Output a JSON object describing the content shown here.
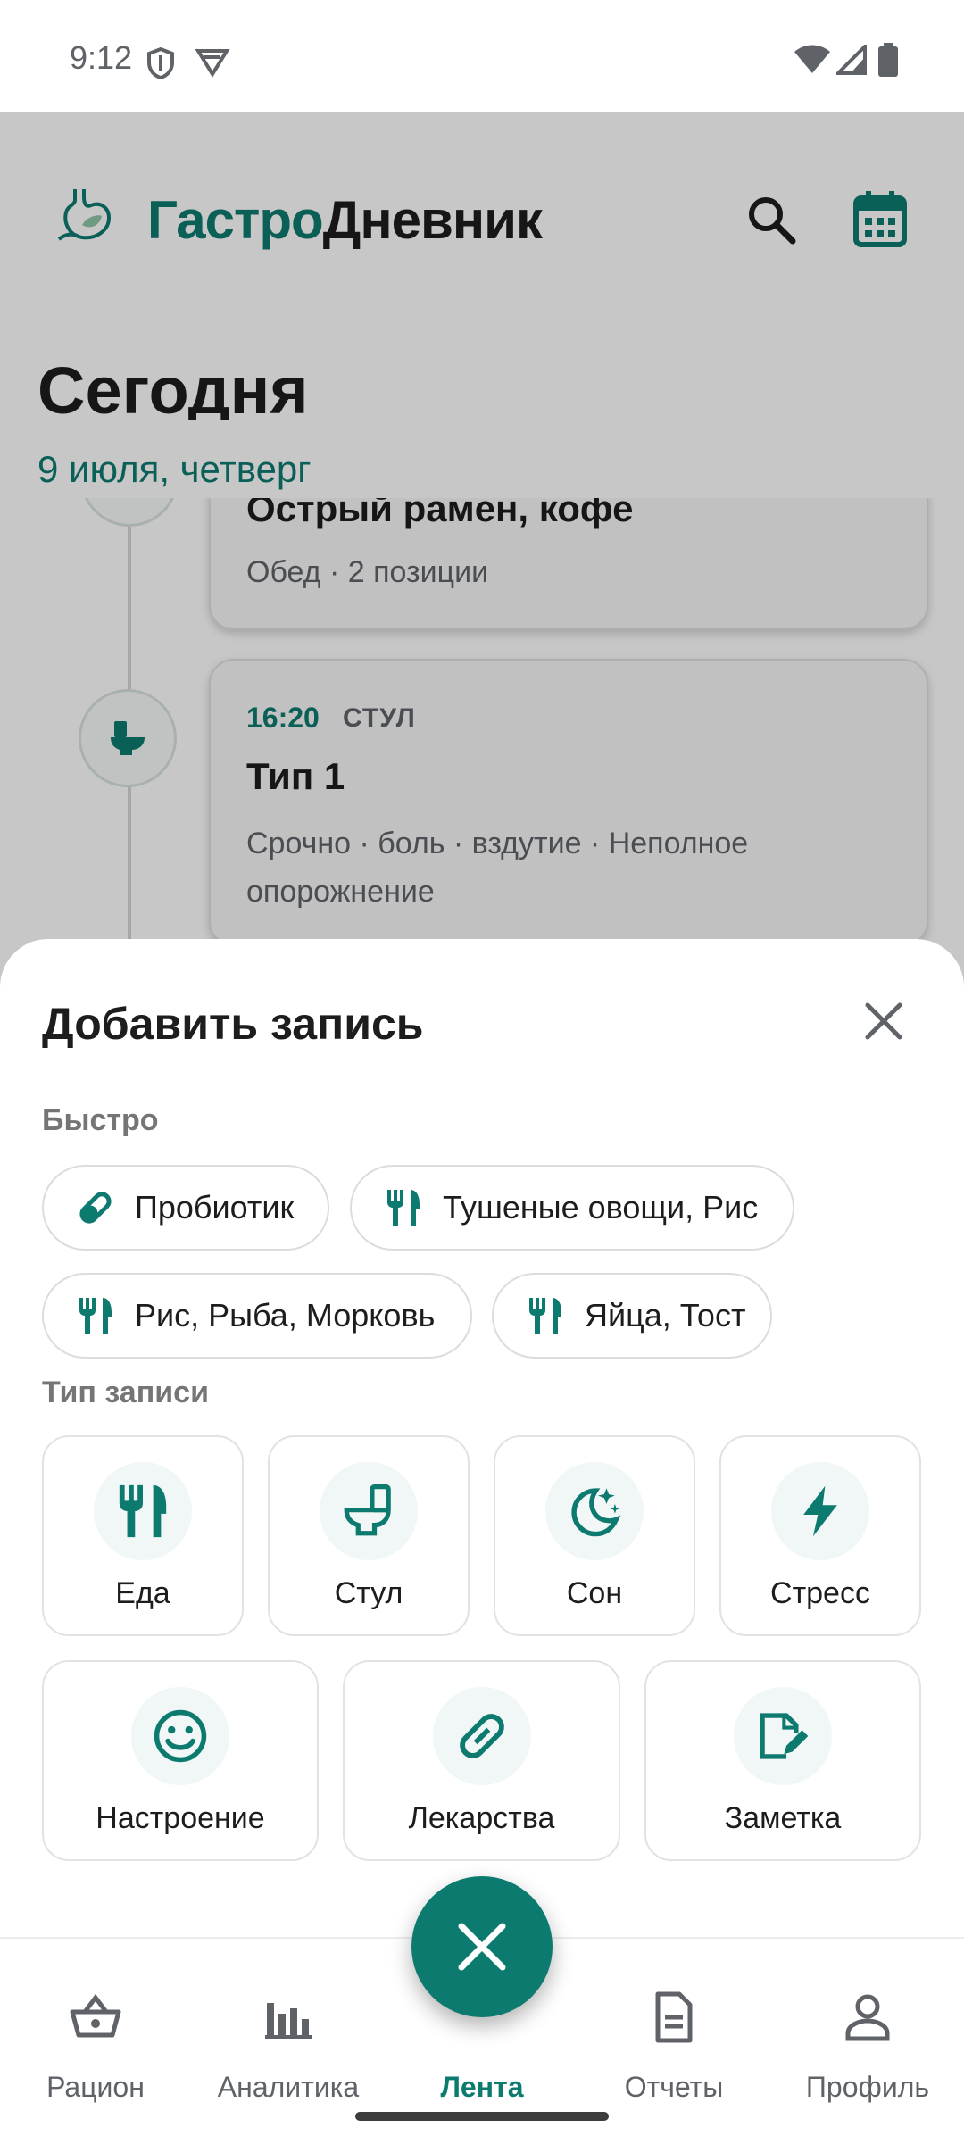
{
  "status_bar": {
    "time": "9:12"
  },
  "app": {
    "title_part1": "Гастро",
    "title_part2": "Дневник",
    "section_title": "Сегодня",
    "date": "9 июля, четверг"
  },
  "feed": {
    "entries": [
      {
        "title": "Острый рамен, кофе",
        "subtitle": "Обед · 2 позиции"
      },
      {
        "time": "16:20",
        "type": "СТУЛ",
        "title": "Тип 1",
        "subtitle": "Срочно · боль · вздутие · Неполное опорожнение"
      }
    ]
  },
  "sheet": {
    "title": "Добавить запись",
    "quick_label": "Быстро",
    "quick_chips": [
      {
        "label": "Пробиотик",
        "icon": "pill-icon"
      },
      {
        "label": "Тушеные овощи, Рис",
        "icon": "fork-knife-icon"
      },
      {
        "label": "Рис, Рыба, Морковь",
        "icon": "fork-knife-icon"
      },
      {
        "label": "Яйца, Тост",
        "icon": "fork-knife-icon"
      }
    ],
    "type_label": "Тип записи",
    "types": [
      {
        "label": "Еда",
        "icon": "fork-knife-icon"
      },
      {
        "label": "Стул",
        "icon": "toilet-icon"
      },
      {
        "label": "Сон",
        "icon": "moon-stars-icon"
      },
      {
        "label": "Стресс",
        "icon": "lightning-icon"
      },
      {
        "label": "Настроение",
        "icon": "smiley-icon"
      },
      {
        "label": "Лекарства",
        "icon": "pill-icon"
      },
      {
        "label": "Заметка",
        "icon": "note-edit-icon"
      }
    ]
  },
  "nav": {
    "items": [
      {
        "label": "Рацион",
        "icon": "basket-icon"
      },
      {
        "label": "Аналитика",
        "icon": "bar-chart-icon"
      },
      {
        "label": "Лента",
        "icon": "close-icon",
        "active": true
      },
      {
        "label": "Отчеты",
        "icon": "document-icon"
      },
      {
        "label": "Профиль",
        "icon": "person-icon"
      }
    ]
  },
  "colors": {
    "accent": "#0d7a70",
    "text": "#1d1d1d",
    "muted": "#5f6368",
    "scrim": "rgba(0,0,0,0.22)"
  }
}
